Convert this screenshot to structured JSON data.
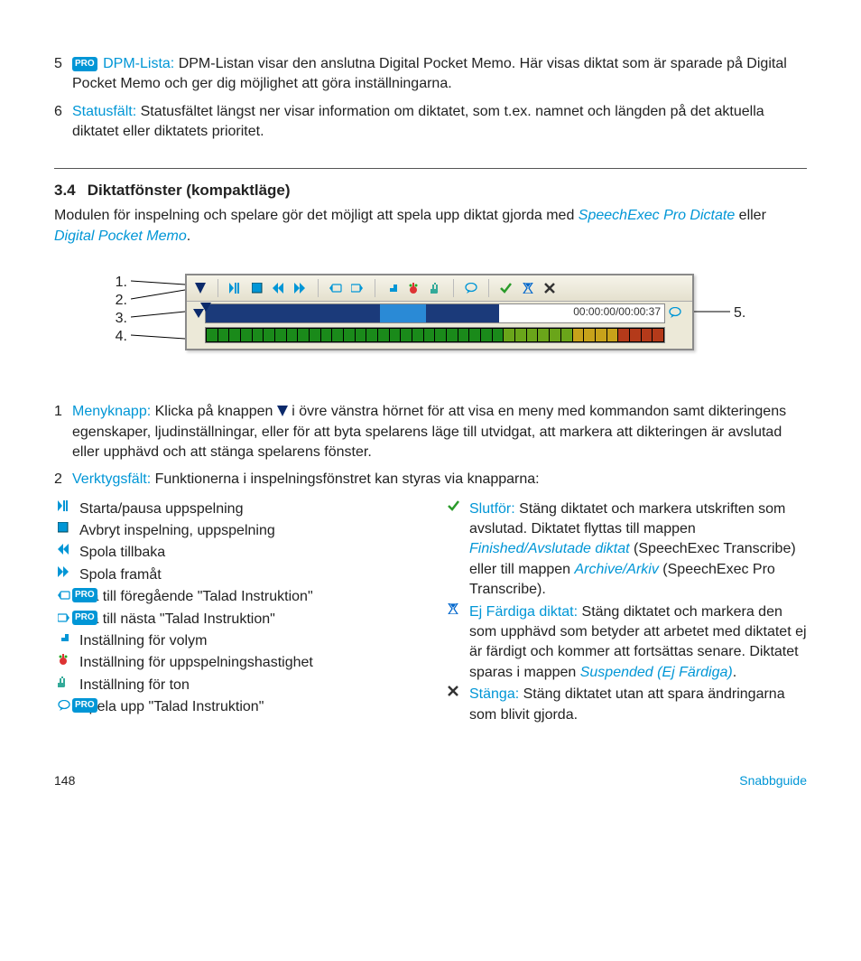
{
  "top_items": [
    {
      "num": "5",
      "pro": true,
      "label": "DPM-Lista:",
      "text": "DPM-Listan visar den anslutna Digital Pocket Memo. Här visas diktat som är sparade på Digital Pocket Memo och ger dig möjlighet att göra inställningarna."
    },
    {
      "num": "6",
      "pro": false,
      "label": "Statusfält:",
      "text": "Statusfältet längst ner visar information om diktatet, som t.ex. namnet och längden på det aktuella diktatet eller diktatets prioritet."
    }
  ],
  "section": {
    "num": "3.4",
    "title": "Diktatfönster (kompaktläge)"
  },
  "intro": {
    "before1": "Modulen för inspelning och spelare gör det möjligt att spela upp diktat gjorda med ",
    "link1": "SpeechExec Pro Dictate",
    "mid": " eller ",
    "link2": "Digital Pocket Memo",
    "after": "."
  },
  "figure": {
    "left_nums": [
      "1.",
      "2.",
      "3.",
      "4."
    ],
    "right_num": "5.",
    "time": "00:00:00/00:00:37"
  },
  "items_after": [
    {
      "num": "1",
      "label": "Menyknapp:",
      "text_before": "Klicka på knappen ",
      "text_after": " i övre vänstra hörnet för att visa en meny med kommandon samt dikteringens egenskaper, ljudinställningar, eller för att byta spelarens läge till utvidgat, att markera att dikteringen är avslutad eller upphävd och att stänga spelarens fönster."
    },
    {
      "num": "2",
      "label": "Verktygsfält:",
      "text": "Funktionerna i inspelningsfönstret kan styras via knapparna:"
    }
  ],
  "left_funcs": [
    {
      "icon": "play",
      "pro": false,
      "text": "Starta/pausa uppspelning"
    },
    {
      "icon": "stop",
      "pro": false,
      "text": "Avbryt inspelning, uppspelning"
    },
    {
      "icon": "rew",
      "pro": false,
      "text": "Spola tillbaka"
    },
    {
      "icon": "fwd",
      "pro": false,
      "text": "Spola framåt"
    },
    {
      "icon": "prev-instr",
      "pro": true,
      "text": "Gå till föregående \"Talad Instruktion\""
    },
    {
      "icon": "next-instr",
      "pro": true,
      "text": "Gå till nästa \"Talad Instruktion\""
    },
    {
      "icon": "vol",
      "pro": false,
      "text": "Inställning för volym"
    },
    {
      "icon": "speed",
      "pro": false,
      "text": "Inställning för uppspelningshastighet"
    },
    {
      "icon": "tone",
      "pro": false,
      "text": "Inställning för ton"
    },
    {
      "icon": "balloon",
      "pro": true,
      "text": "Spela upp \"Talad Instruktion\""
    }
  ],
  "right_funcs": [
    {
      "icon": "check",
      "lead": "Slutför:",
      "parts": [
        {
          "t": "text",
          "v": "Stäng diktatet och markera utskriften som avslutad. Diktatet flyttas till mappen "
        },
        {
          "t": "link",
          "v": "Finished/Avslutade diktat"
        },
        {
          "t": "text",
          "v": " (SpeechExec Transcribe) eller till mappen "
        },
        {
          "t": "link",
          "v": "Archive/Arkiv"
        },
        {
          "t": "text",
          "v": " (SpeechExec Pro Transcribe)."
        }
      ]
    },
    {
      "icon": "hourglass",
      "lead": "Ej Färdiga diktat:",
      "parts": [
        {
          "t": "text",
          "v": "Stäng diktatet och markera den som upphävd som betyder att arbetet med diktatet ej är färdigt och kommer att fortsättas senare. Diktatet sparas i mappen "
        },
        {
          "t": "link",
          "v": "Suspended (Ej Färdiga)"
        },
        {
          "t": "text",
          "v": "."
        }
      ]
    },
    {
      "icon": "close",
      "lead": "Stänga:",
      "parts": [
        {
          "t": "text",
          "v": "Stäng diktatet utan att spara ändringarna som blivit gjorda."
        }
      ]
    }
  ],
  "footer": {
    "page": "148",
    "label": "Snabbguide"
  },
  "pro_text": "PRO"
}
